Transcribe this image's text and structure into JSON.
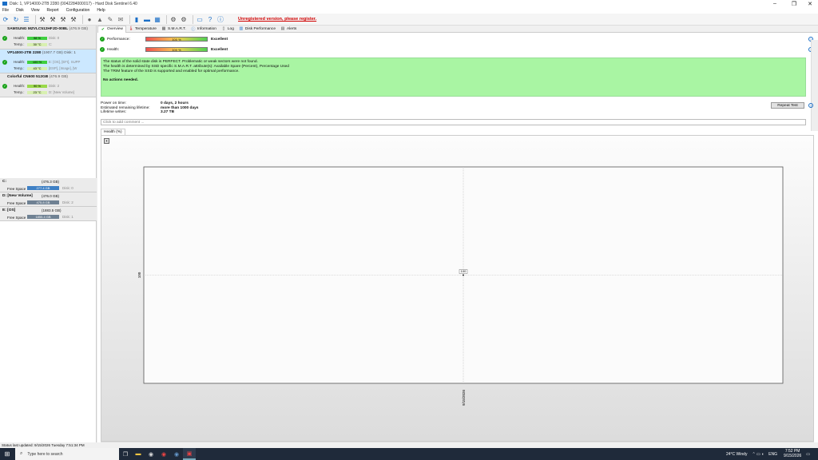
{
  "window": {
    "title": "Disk: 1, VP14000-2TB 2280 (0042284000017) - Hard Disk Sentinel 6.40"
  },
  "menu": [
    "File",
    "Disk",
    "View",
    "Report",
    "Configuration",
    "Help"
  ],
  "toolbar": {
    "register_text": "Unregistered version, please register."
  },
  "disks": [
    {
      "name": "SAMSUNG MZVLC512HFJD-00BL",
      "capacity": "(476.9 GB)",
      "health_label": "Health:",
      "health": "98 %",
      "temp_label": "Temp.:",
      "temp": "30 °C",
      "disk_id": "Disk: 0",
      "extra": "C:",
      "selected": false
    },
    {
      "name": "VP14000-2TB 2280",
      "capacity": "(1907.7 GB)",
      "health_label": "Health:",
      "health": "100 %",
      "temp_label": "Temp.:",
      "temp": "43 °C",
      "disk_id": "Disk: 1",
      "extra": "E: [OS], [EFI], SUPP",
      "extra2": "[ESP], [Image], [W",
      "selected": true
    },
    {
      "name": "Colorful CN600 512GB",
      "capacity": "(476.9 GB)",
      "health_label": "Health:",
      "health": "90 %",
      "temp_label": "Temp.:",
      "temp": "23 °C",
      "disk_id": "Disk: 2",
      "extra": "D: [New Volume]",
      "selected": false
    }
  ],
  "volumes": [
    {
      "name": "C:",
      "capacity": "(476.3 GB)",
      "free_label": "Free Space",
      "free": "277.4 GB",
      "disk": "Disk: 0"
    },
    {
      "name": "D: [New Volume]",
      "capacity": "(476.0 GB)",
      "free_label": "Free Space",
      "free": "475.8 GB",
      "disk": "Disk: 2"
    },
    {
      "name": "E: [OS]",
      "capacity": "(1883.5 GB)",
      "free_label": "Free Space",
      "free": "1855.4 GB",
      "disk": "Disk: 1"
    }
  ],
  "tabs": [
    "Overview",
    "Temperature",
    "S.M.A.R.T.",
    "Information",
    "Log",
    "Disk Performance",
    "Alerts"
  ],
  "performance": {
    "label": "Performance:",
    "value": "100 %",
    "text": "Excellent",
    "level": 1.0
  },
  "health": {
    "label": "Health:",
    "value": "100 %",
    "text": "Excellent",
    "level": 1.0
  },
  "status": {
    "line1": "The status of the solid state disk is PERFECT. Problematic or weak sectors were not found.",
    "line2": "The health is determined by SSD specific S.M.A.R.T. attribute(s):  Available Spare (Percent), Percentage Used",
    "line3": "The TRIM feature of the SSD is supported and enabled for optimal performance.",
    "actions": "No actions needed."
  },
  "info": {
    "power_on_label": "Power on time:",
    "power_on": "0 days, 2 hours",
    "remaining_label": "Estimated remaining lifetime:",
    "remaining": "more than 1000 days",
    "writes_label": "Lifetime writes:",
    "writes": "3.27 TB"
  },
  "repeat_test_label": "Repeat Test",
  "comment_placeholder": "Click to add comment ...",
  "chart_tab": "Health (%)",
  "chart_data": {
    "type": "line",
    "title": "",
    "x": [
      "9/15/2026"
    ],
    "series": [
      {
        "values": [
          100
        ]
      }
    ],
    "ytick": "100",
    "point_label": "100"
  },
  "statusbar": "Status last updated: 9/15/2026 Tuesday 7:51:34 PM",
  "taskbar": {
    "search_placeholder": "Type here to search",
    "weather": "24°C  Windy",
    "lang": "ENG",
    "time": "7:52 PM",
    "date": "9/15/2026"
  }
}
